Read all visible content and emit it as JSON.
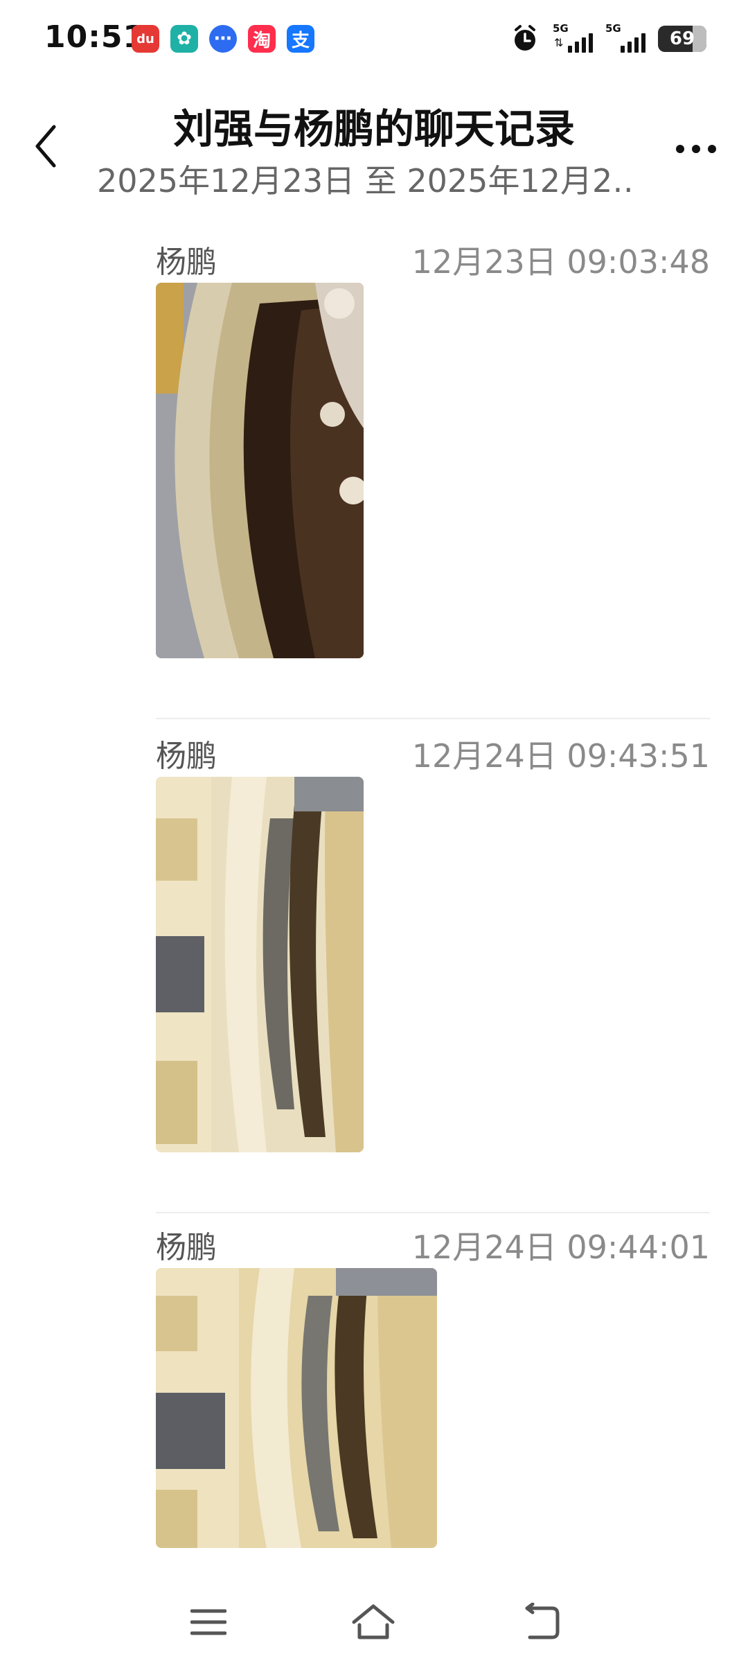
{
  "status_bar": {
    "time": "10:51",
    "app_icons": [
      {
        "name": "map-app-icon",
        "glyph": "du",
        "color": "#e53935"
      },
      {
        "name": "china-mobile-app-icon",
        "glyph": "✿",
        "color": "#1fb0a6"
      },
      {
        "name": "message-app-icon",
        "glyph": "⋯",
        "color": "#2d6cf0"
      },
      {
        "name": "taobao-app-icon",
        "glyph": "淘",
        "color": "#ff2e4d"
      },
      {
        "name": "alipay-app-icon",
        "glyph": "支",
        "color": "#1677ff"
      }
    ],
    "signal_1_label": "5G",
    "signal_2_label": "5G",
    "battery_level": "69"
  },
  "header": {
    "title": "刘强与杨鹏的聊天记录",
    "subtitle": "2025年12月23日 至 2025年12月2…"
  },
  "messages": [
    {
      "sender": "杨鹏",
      "timestamp": "12月23日 09:03:48",
      "image": "rusty-disc-photo-1"
    },
    {
      "sender": "杨鹏",
      "timestamp": "12月24日 09:43:51",
      "image": "rusty-disc-photo-2"
    },
    {
      "sender": "杨鹏",
      "timestamp": "12月24日 09:44:01",
      "image": "rusty-disc-photo-3"
    }
  ],
  "nav_bar": {
    "menu_icon": "menu-icon",
    "home_icon": "home-icon",
    "back_icon": "back-icon"
  }
}
